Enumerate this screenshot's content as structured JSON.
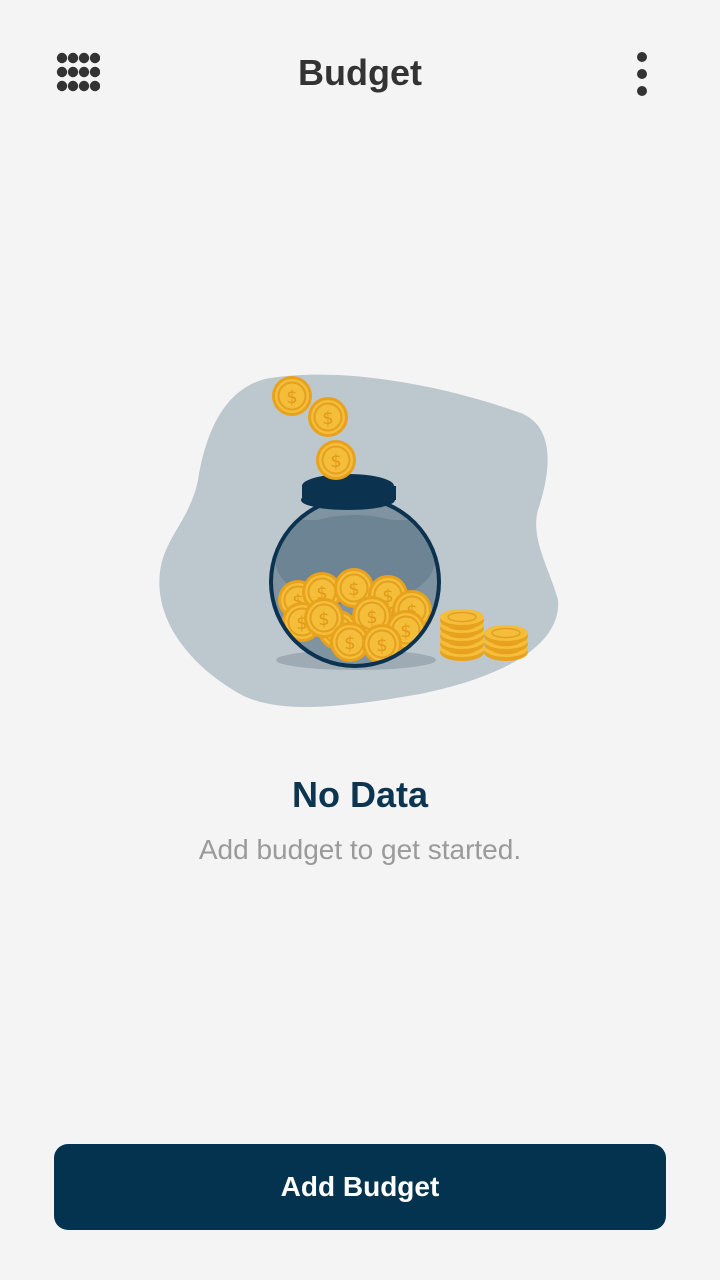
{
  "header": {
    "title": "Budget",
    "left_icon": "grid-menu-icon",
    "right_icon": "more-vertical-icon"
  },
  "empty_state": {
    "illustration": "coin-jar-illustration",
    "title": "No Data",
    "subtitle": "Add budget to get started."
  },
  "footer": {
    "add_button_label": "Add Budget"
  },
  "colors": {
    "background": "#f4f4f4",
    "primary": "#04334f",
    "title_text": "#333333",
    "empty_title": "#0e3550",
    "subtitle_text": "#9a9a9a",
    "coin": "#f2b631"
  }
}
